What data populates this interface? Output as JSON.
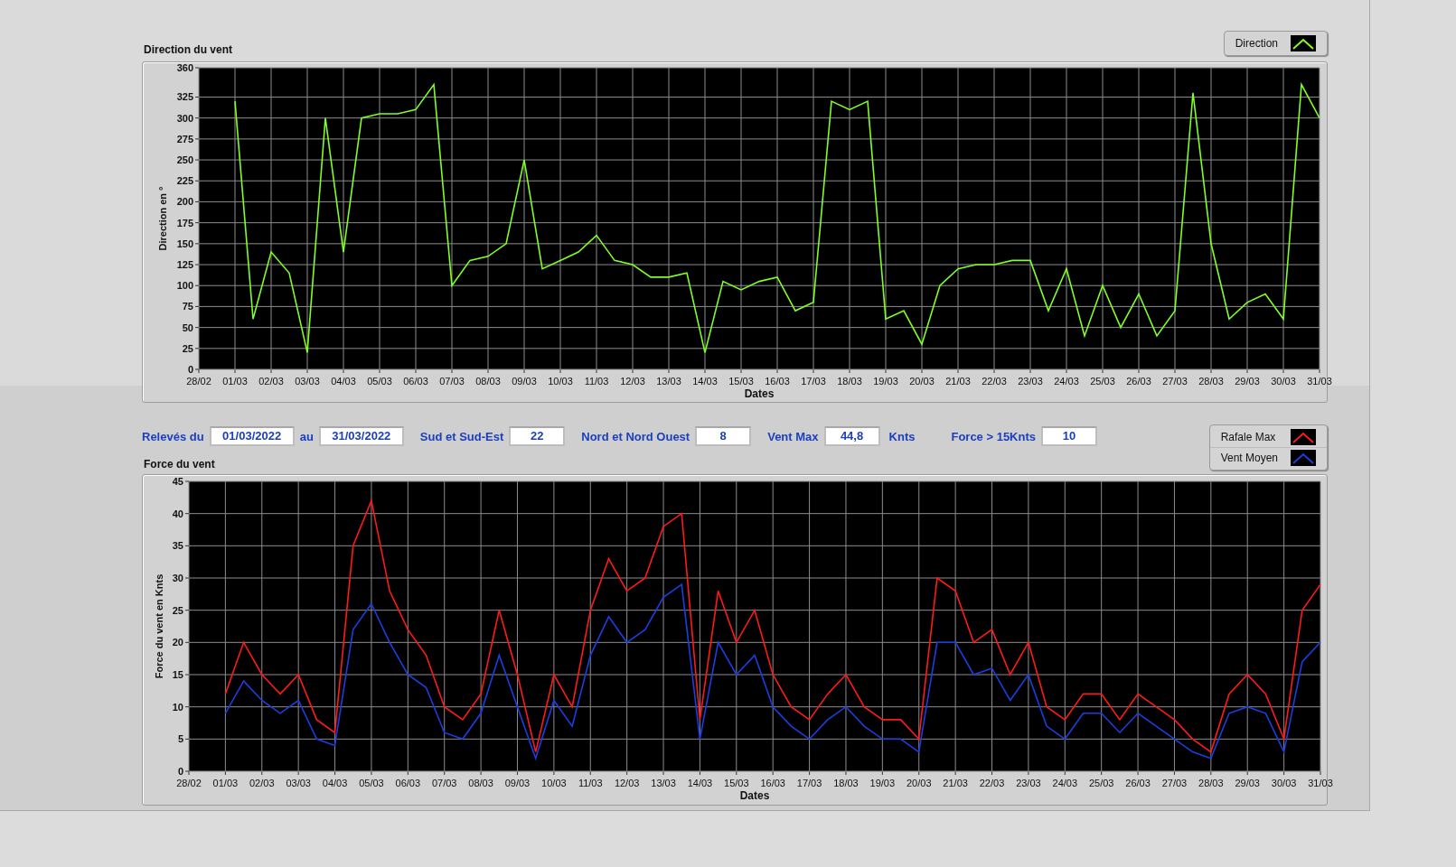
{
  "direction_chart": {
    "title": "Direction du vent",
    "chart_data": {
      "type": "line",
      "xlabel": "Dates",
      "ylabel": "Direction en °",
      "categories": [
        "28/02",
        null,
        "01/03",
        null,
        "02/03",
        null,
        "03/03",
        null,
        "04/03",
        null,
        "05/03",
        null,
        "06/03",
        null,
        "07/03",
        null,
        "08/03",
        null,
        "09/03",
        null,
        "10/03",
        null,
        "11/03",
        null,
        "12/03",
        null,
        "13/03",
        null,
        "14/03",
        null,
        "15/03",
        null,
        "16/03",
        null,
        "17/03",
        null,
        "18/03",
        null,
        "19/03",
        null,
        "20/03",
        null,
        "21/03",
        null,
        "22/03",
        null,
        "23/03",
        null,
        "24/03",
        null,
        "25/03",
        null,
        "26/03",
        null,
        "27/03",
        null,
        "28/03",
        null,
        "29/03",
        null,
        "30/03",
        null,
        "31/03"
      ],
      "series": [
        {
          "name": "Direction",
          "color": "#80ff20",
          "values": [
            null,
            null,
            320,
            60,
            140,
            115,
            20,
            300,
            140,
            300,
            305,
            305,
            310,
            340,
            100,
            130,
            135,
            150,
            250,
            120,
            130,
            140,
            160,
            130,
            125,
            110,
            110,
            115,
            20,
            105,
            95,
            105,
            110,
            70,
            80,
            320,
            310,
            320,
            60,
            70,
            30,
            100,
            120,
            125,
            125,
            130,
            130,
            70,
            120,
            40,
            100,
            50,
            90,
            40,
            70,
            330,
            150,
            60,
            80,
            90,
            60,
            340,
            300
          ]
        }
      ],
      "ylim": [
        0,
        360
      ],
      "grid": true,
      "yticks": [
        0,
        25,
        50,
        75,
        100,
        125,
        150,
        175,
        200,
        225,
        250,
        275,
        300,
        325,
        360
      ]
    }
  },
  "summary": {
    "fields": [
      {
        "kind": "date",
        "label": "Relevés du",
        "value": "01/03/2022"
      },
      {
        "kind": "date",
        "label": "au",
        "value": "31/03/2022"
      },
      {
        "kind": "number",
        "label": "Sud et Sud-Est",
        "value": "22"
      },
      {
        "kind": "number",
        "label": "Nord et Nord Ouest",
        "value": "8"
      },
      {
        "kind": "number",
        "label": "Vent Max",
        "value": "44,8",
        "unit": "Knts"
      },
      {
        "kind": "number",
        "label": "Force > 15Knts",
        "value": "10"
      }
    ]
  },
  "force_chart": {
    "title": "Force du vent",
    "chart_data": {
      "type": "line",
      "xlabel": "Dates",
      "ylabel": "Force du vent en Knts",
      "categories": [
        "28/02",
        null,
        "01/03",
        null,
        "02/03",
        null,
        "03/03",
        null,
        "04/03",
        null,
        "05/03",
        null,
        "06/03",
        null,
        "07/03",
        null,
        "08/03",
        null,
        "09/03",
        null,
        "10/03",
        null,
        "11/03",
        null,
        "12/03",
        null,
        "13/03",
        null,
        "14/03",
        null,
        "15/03",
        null,
        "16/03",
        null,
        "17/03",
        null,
        "18/03",
        null,
        "19/03",
        null,
        "20/03",
        null,
        "21/03",
        null,
        "22/03",
        null,
        "23/03",
        null,
        "24/03",
        null,
        "25/03",
        null,
        "26/03",
        null,
        "27/03",
        null,
        "28/03",
        null,
        "29/03",
        null,
        "30/03",
        null,
        "31/03"
      ],
      "series": [
        {
          "name": "Rafale Max",
          "color": "#ff1a1a",
          "values": [
            null,
            null,
            12,
            20,
            15,
            12,
            15,
            8,
            6,
            35,
            42,
            28,
            22,
            18,
            10,
            8,
            12,
            25,
            15,
            3,
            15,
            10,
            25,
            33,
            28,
            30,
            38,
            40,
            8,
            28,
            20,
            25,
            15,
            10,
            8,
            12,
            15,
            10,
            8,
            8,
            5,
            30,
            28,
            20,
            22,
            15,
            20,
            10,
            8,
            12,
            12,
            8,
            12,
            10,
            8,
            5,
            3,
            12,
            15,
            12,
            5,
            25,
            29
          ]
        },
        {
          "name": "Vent Moyen",
          "color": "#1a3fe0",
          "values": [
            null,
            null,
            9,
            14,
            11,
            9,
            11,
            5,
            4,
            22,
            26,
            20,
            15,
            13,
            6,
            5,
            9,
            18,
            10,
            2,
            11,
            7,
            18,
            24,
            20,
            22,
            27,
            29,
            5,
            20,
            15,
            18,
            10,
            7,
            5,
            8,
            10,
            7,
            5,
            5,
            3,
            20,
            20,
            15,
            16,
            11,
            15,
            7,
            5,
            9,
            9,
            6,
            9,
            7,
            5,
            3,
            2,
            9,
            10,
            9,
            3,
            17,
            20
          ]
        }
      ],
      "ylim": [
        0,
        45
      ],
      "grid": true,
      "yticks": [
        0,
        5,
        10,
        15,
        20,
        25,
        30,
        35,
        40,
        45
      ]
    }
  }
}
